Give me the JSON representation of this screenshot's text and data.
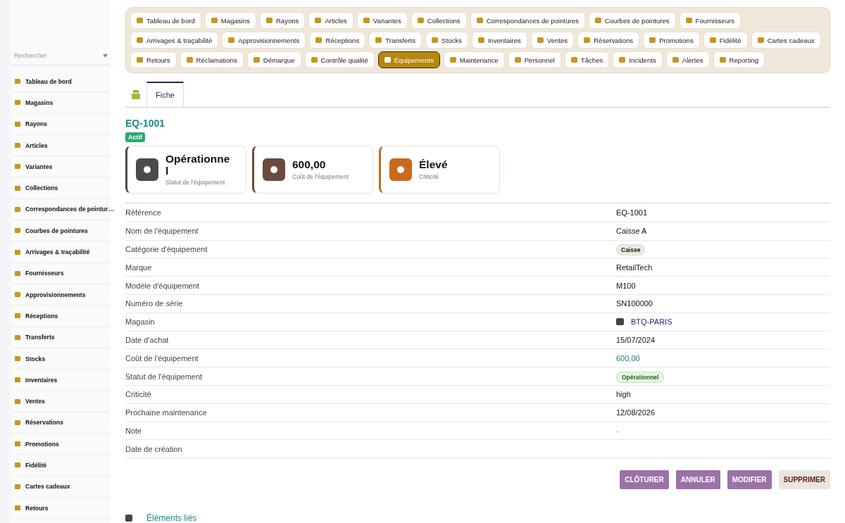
{
  "sidebar": {
    "search": {
      "placeholder": "Rechercher"
    },
    "items": [
      {
        "label": "Tableau de bord"
      },
      {
        "label": "Magasins"
      },
      {
        "label": "Rayons"
      },
      {
        "label": "Articles"
      },
      {
        "label": "Variantes"
      },
      {
        "label": "Collections"
      },
      {
        "label": "Correspondances de pointur…"
      },
      {
        "label": "Courbes de pointures"
      },
      {
        "label": "Arrivages & traçabilité"
      },
      {
        "label": "Fournisseurs"
      },
      {
        "label": "Approvisionnements"
      },
      {
        "label": "Réceptions"
      },
      {
        "label": "Transferts"
      },
      {
        "label": "Stocks"
      },
      {
        "label": "Inventaires"
      },
      {
        "label": "Ventes"
      },
      {
        "label": "Réservations"
      },
      {
        "label": "Promotions"
      },
      {
        "label": "Fidélité"
      },
      {
        "label": "Cartes cadeaux"
      },
      {
        "label": "Retours"
      }
    ]
  },
  "nav": [
    [
      {
        "label": "Tableau de bord",
        "selected": false
      },
      {
        "label": "Magasins",
        "selected": false
      },
      {
        "label": "Rayons",
        "selected": false
      },
      {
        "label": "Articles",
        "selected": false
      },
      {
        "label": "Variantes",
        "selected": false
      },
      {
        "label": "Collections",
        "selected": false
      },
      {
        "label": "Correspondances de pointures",
        "selected": false
      },
      {
        "label": "Courbes de pointures",
        "selected": false
      },
      {
        "label": "Fournisseurs",
        "selected": false
      }
    ],
    [
      {
        "label": "Arrivages & traçabilité",
        "selected": false
      },
      {
        "label": "Approvisionnements",
        "selected": false
      },
      {
        "label": "Réceptions",
        "selected": false
      },
      {
        "label": "Transferts",
        "selected": false
      },
      {
        "label": "Stocks",
        "selected": false
      },
      {
        "label": "Inventaires",
        "selected": false
      },
      {
        "label": "Ventes",
        "selected": false
      },
      {
        "label": "Réservations",
        "selected": false
      },
      {
        "label": "Promotions",
        "selected": false
      },
      {
        "label": "Fidélité",
        "selected": false
      },
      {
        "label": "Cartes cadeaux",
        "selected": false
      }
    ],
    [
      {
        "label": "Retours",
        "selected": false
      },
      {
        "label": "Réclamations",
        "selected": false
      },
      {
        "label": "Démarque",
        "selected": false
      },
      {
        "label": "Contrôle qualité",
        "selected": false
      },
      {
        "label": "Équipements",
        "selected": true
      },
      {
        "label": "Maintenance",
        "selected": false
      },
      {
        "label": "Personnel",
        "selected": false
      },
      {
        "label": "Tâches",
        "selected": false
      },
      {
        "label": "Incidents",
        "selected": false
      },
      {
        "label": "Alertes",
        "selected": false
      },
      {
        "label": "Reporting",
        "selected": false
      }
    ]
  ],
  "tabs": [
    {
      "kind": "icon",
      "selected": false
    },
    {
      "kind": "text",
      "label": "Fiche",
      "selected": true
    }
  ],
  "record": {
    "title": "EQ-1001",
    "badge": "Actif"
  },
  "cards": [
    {
      "value": "Opérationnel",
      "label": "Statut de l'équipement",
      "color": "#4a4a4a"
    },
    {
      "value": "600,00",
      "label": "Coût de l'équipement",
      "color": "#6b4a3e"
    },
    {
      "value": "Élevé",
      "label": "Criticité",
      "color": "#c8691c"
    }
  ],
  "fields": [
    {
      "label": "Référence",
      "kind": "text",
      "value": "EQ-1001"
    },
    {
      "label": "Nom de l'équipement",
      "kind": "text",
      "value": "Caisse A"
    },
    {
      "label": "Catégorie d'équipement",
      "kind": "tag",
      "value": "Caisse"
    },
    {
      "label": "Marque",
      "kind": "text",
      "value": "RetailTech"
    },
    {
      "label": "Modèle d'équipement",
      "kind": "text",
      "value": "M100"
    },
    {
      "label": "Numéro de série",
      "kind": "text",
      "value": "SN100000"
    },
    {
      "label": "Magasin",
      "kind": "link",
      "value": "BTQ-PARIS"
    },
    {
      "label": "Date d'achat",
      "kind": "text",
      "value": "15/07/2024"
    },
    {
      "label": "Coût de l'équipement",
      "kind": "amount",
      "value": "600,00"
    },
    {
      "label": "Statut de l'équipement",
      "kind": "status",
      "value": "Opérationnel"
    },
    {
      "label": "Criticité",
      "kind": "text",
      "value": "high"
    },
    {
      "label": "Prochaine maintenance",
      "kind": "text",
      "value": "12/08/2026"
    },
    {
      "label": "Note",
      "kind": "muted",
      "value": "-"
    },
    {
      "label": "Date de création",
      "kind": "text"
    }
  ],
  "actions": [
    {
      "label": "CLÔTURER",
      "kind": "primary"
    },
    {
      "label": "ANNULER",
      "kind": "primary"
    },
    {
      "label": "MODIFIER",
      "kind": "primary"
    },
    {
      "label": "SUPPRIMER",
      "kind": "danger"
    }
  ],
  "related": {
    "title": "Éléments liés"
  }
}
